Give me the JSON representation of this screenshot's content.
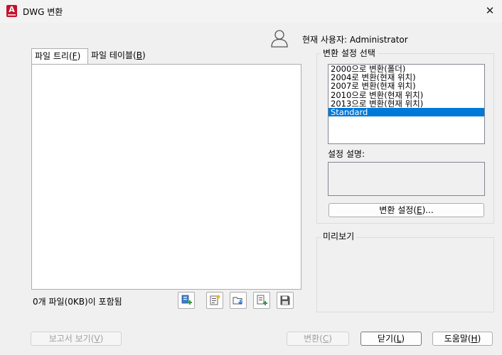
{
  "window": {
    "title": "DWG 변환",
    "close_glyph": "✕"
  },
  "user": {
    "label": "현재 사용자: Administrator",
    "icon": "user-icon"
  },
  "tabs": [
    {
      "label": "파일 트리(",
      "hotkey": "F",
      "suffix": ")",
      "active": true
    },
    {
      "label": "파일 테이블(",
      "hotkey": "B",
      "suffix": ")",
      "active": false
    }
  ],
  "file_status": "0개 파일(0KB)이 포함됨",
  "toolbar_icons": [
    "add-files-icon",
    "add-sheet-set-icon",
    "open-list-icon",
    "append-list-icon",
    "save-list-icon"
  ],
  "conversion_setup": {
    "title": "변환 설정 선택",
    "items": [
      "2000으로 변환(폴더)",
      "2004로 변환(현재 위치)",
      "2007로 변환(현재 위치)",
      "2010으로 변환(현재 위치)",
      "2013으로 변환(현재 위치)",
      "Standard"
    ],
    "selected": "Standard",
    "desc_label": "설정 설명:",
    "button": {
      "prefix": "변환 설정(",
      "hotkey": "E",
      "suffix": ")..."
    }
  },
  "preview": {
    "title": "미리보기"
  },
  "buttons": {
    "report": {
      "prefix": "보고서 보기(",
      "hotkey": "V",
      "suffix": ")"
    },
    "convert": {
      "prefix": "변환(",
      "hotkey": "C",
      "suffix": ")"
    },
    "close": {
      "prefix": "닫기(",
      "hotkey": "L",
      "suffix": ")"
    },
    "help": {
      "prefix": "도움말(",
      "hotkey": "H",
      "suffix": ")"
    }
  },
  "colors": {
    "accent": "#0078d7",
    "app_logo": "#c8102e"
  }
}
